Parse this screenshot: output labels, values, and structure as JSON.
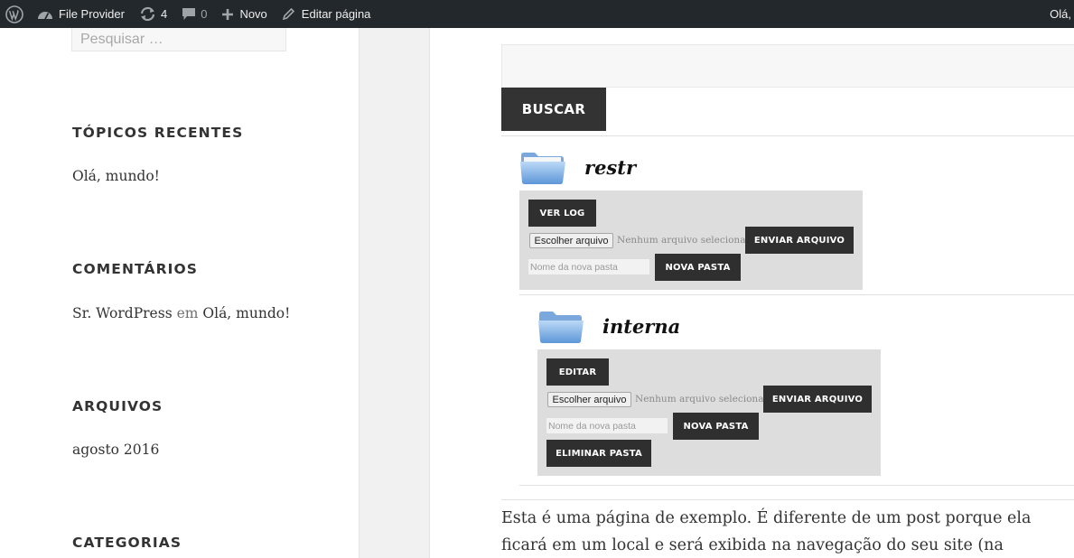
{
  "admin_bar": {
    "wp_logo_icon": "wordpress-icon",
    "site_name": "File Provider",
    "updates_count": "4",
    "comments_count": "0",
    "new_label": "Novo",
    "edit_label": "Editar página",
    "greeting": "Olá,"
  },
  "sidebar": {
    "search_placeholder": "Pesquisar …",
    "recent_posts": {
      "title": "TÓPICOS RECENTES",
      "item": "Olá, mundo!"
    },
    "comments": {
      "title": "COMENTÁRIOS",
      "author": "Sr. WordPress",
      "connector": "em",
      "post": "Olá, mundo!"
    },
    "archives": {
      "title": "ARQUIVOS",
      "item": "agosto 2016"
    },
    "categories": {
      "title": "CATEGORIAS"
    }
  },
  "main": {
    "search_button": "BUSCAR",
    "folders": [
      {
        "name": "restr",
        "first_button": "VER LOG",
        "choose_file": "Escolher arquivo",
        "no_file": "Nenhum arquivo selecionado",
        "send_file": "ENVIAR ARQUIVO",
        "new_folder_placeholder": "Nome da nova pasta",
        "new_folder_button": "NOVA PASTA"
      },
      {
        "name": "interna",
        "first_button": "EDITAR",
        "choose_file": "Escolher arquivo",
        "no_file": "Nenhum arquivo selecionado",
        "send_file": "ENVIAR ARQUIVO",
        "new_folder_placeholder": "Nome da nova pasta",
        "new_folder_button": "NOVA PASTA",
        "delete_folder_button": "ELIMINAR PASTA"
      }
    ],
    "body_line_1": "Esta é uma página de exemplo. É diferente de um post porque ela",
    "body_line_2": "ficará em um local e será exibida na navegação do seu site (na"
  },
  "colors": {
    "admin_bar_bg": "#23282d",
    "button_dark": "#333333",
    "panel_bg": "#dddddd",
    "band_bg": "#f1f1f1"
  }
}
